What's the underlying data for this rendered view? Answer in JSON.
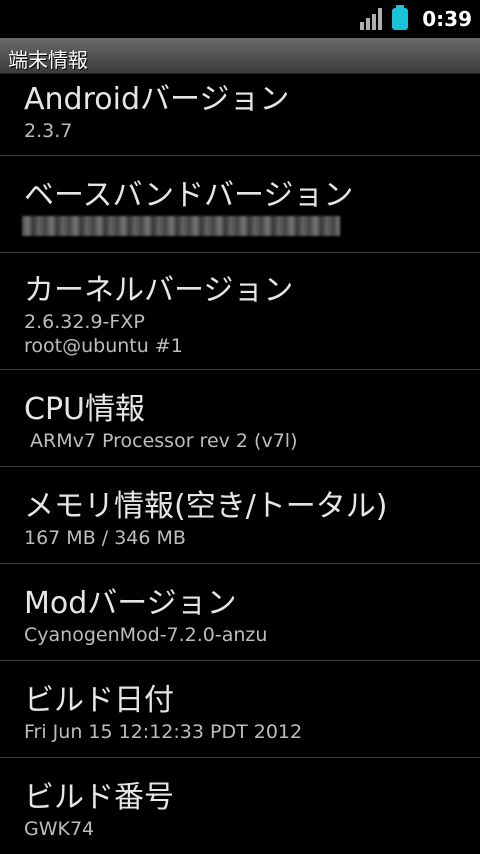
{
  "status_bar": {
    "time": "0:39",
    "icons": [
      "signal-icon",
      "battery-icon"
    ],
    "battery_color": "#19c3d8"
  },
  "title_bar": {
    "title": "端末情報"
  },
  "items": [
    {
      "title": "Androidバージョン",
      "summary": "2.3.7"
    },
    {
      "title": "ベースバンドバージョン",
      "summary": ""
    },
    {
      "title": "カーネルバージョン",
      "summary": "2.6.32.9-FXP\nroot@ubuntu #1"
    },
    {
      "title": "CPU情報",
      "summary": " ARMv7 Processor rev 2 (v7l)"
    },
    {
      "title": "メモリ情報(空き/トータル)",
      "summary": "167 MB / 346 MB"
    },
    {
      "title": "Modバージョン",
      "summary": "CyanogenMod-7.2.0-anzu"
    },
    {
      "title": "ビルド日付",
      "summary": "Fri Jun 15 12:12:33 PDT 2012"
    },
    {
      "title": "ビルド番号",
      "summary": "GWK74"
    }
  ]
}
